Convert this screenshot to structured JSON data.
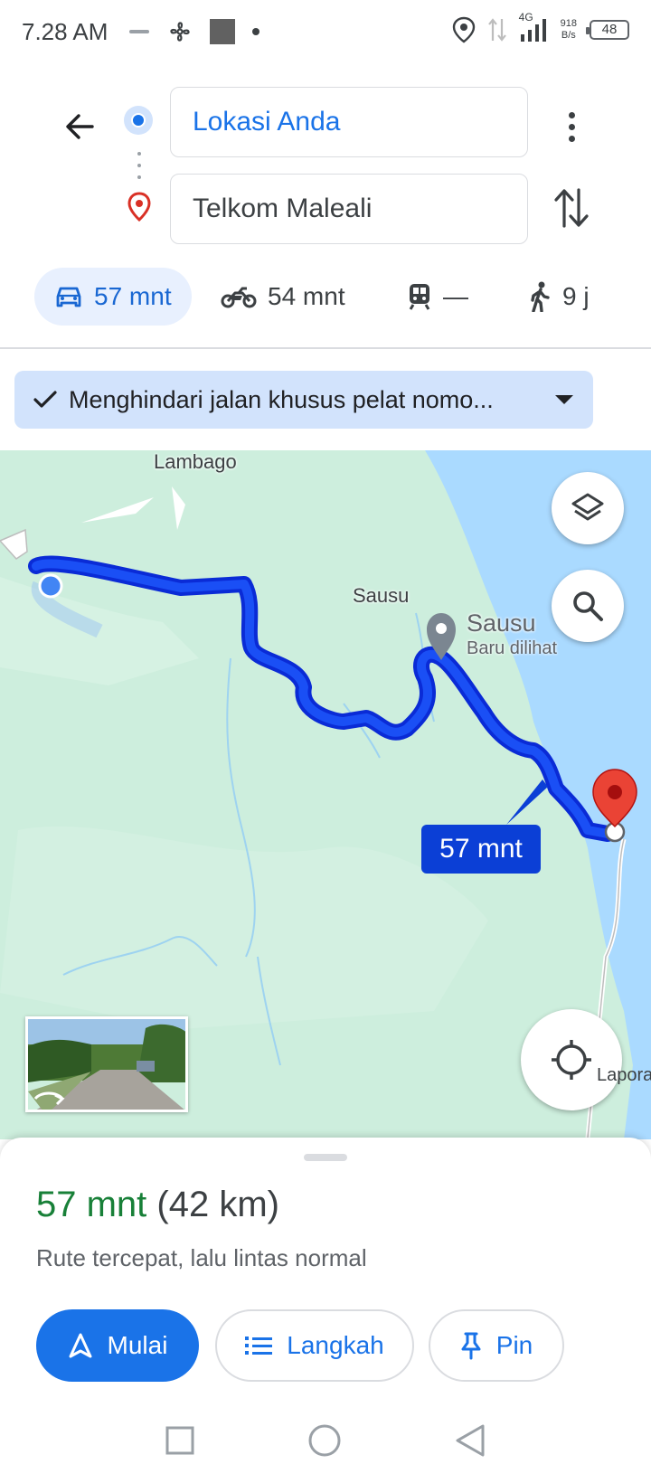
{
  "status_bar": {
    "time": "7.28 AM",
    "network": "4G",
    "speed_value": "918",
    "speed_unit": "B/s",
    "battery": "48",
    "icons": [
      "location-icon",
      "data-arrows-icon",
      "signal-icon",
      "battery-icon",
      "fan-icon",
      "square-icon",
      "dot-icon"
    ]
  },
  "directions": {
    "origin": "Lokasi Anda",
    "destination": "Telkom Maleali"
  },
  "modes": [
    {
      "name": "car",
      "label": "57 mnt",
      "active": true
    },
    {
      "name": "motorcycle",
      "label": "54 mnt",
      "active": false
    },
    {
      "name": "transit",
      "label": "—",
      "active": false
    },
    {
      "name": "walk",
      "label": "9 j",
      "active": false
    }
  ],
  "filter_chip": {
    "label": "Menghindari jalan khusus pelat nomo..."
  },
  "map": {
    "labels": {
      "lambago": "Lambago",
      "sausu_town": "Sausu",
      "sausu_poi": "Sausu",
      "sausu_poi_sub": "Baru dilihat",
      "lapora": "Lapora"
    },
    "route_eta": "57 mnt",
    "colors": {
      "route": "#1a3ff0",
      "land": "#cdeedd",
      "water": "#aadaff",
      "destination_pin": "#ea4335"
    }
  },
  "summary": {
    "time": "57 mnt",
    "distance": "(42 km)",
    "description": "Rute tercepat, lalu lintas normal"
  },
  "actions": {
    "start": "Mulai",
    "steps": "Langkah",
    "pin": "Pin"
  }
}
